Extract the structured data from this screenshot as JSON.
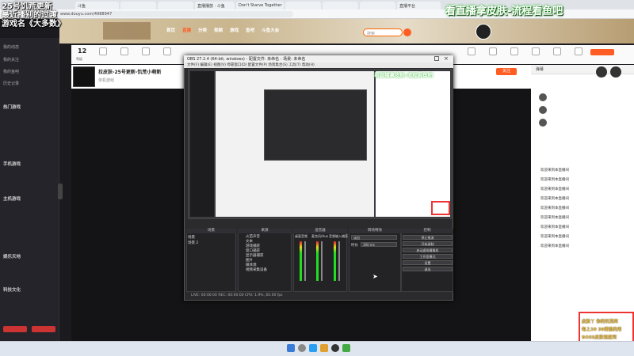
{
  "browser": {
    "tabs": [
      "斗鱼",
      "",
      "",
      "直播播放 · 斗鱼",
      "Don't Starve Together",
      "",
      "",
      "",
      "直播平台"
    ],
    "address": "www.douyu.com/4988947"
  },
  "overlay": {
    "left_caption_line1": "25号饥荒更新",
    "left_caption_line2": "最近播别的过渡",
    "left_caption_line3": "游戏名《大多数》",
    "right_caption": "看直播拿皮肤-流程看鱼吧"
  },
  "banner": {
    "nav": [
      "首页",
      "直播",
      "分类",
      "视频",
      "游戏",
      "鱼吧",
      "斗鱼大会"
    ],
    "search_placeholder": "搜索"
  },
  "sidebar": {
    "top_items": [
      "我的动态",
      "我的关注",
      "我的鱼吧",
      "历史记录"
    ],
    "sections": [
      "热门游戏",
      "手机游戏",
      "主机游戏",
      "娱乐天地",
      "科技文化"
    ]
  },
  "iconrow": {
    "level": "12",
    "labels": [
      "等级",
      "",
      "",
      "",
      "",
      "",
      "",
      "",
      "",
      "",
      "",
      "",
      "",
      "",
      "",
      "",
      "",
      "",
      "",
      "",
      "",
      "",
      "",
      ""
    ]
  },
  "room": {
    "title": "拉皮肤-25号更新-饥荒小萌新",
    "subtitle": "单机游戏",
    "follow_label": "关注"
  },
  "obs": {
    "title": "OBS 27.2.4 (64-bit, windows) - 配置文件: 未命名 - 场景: 未命名",
    "menu": "文件(F)  编辑(E)  视图(V)  停靠窗口(D)  配置文件(P)  场景集合(S)  工具(T)  帮助(H)",
    "preview_caption": "看直播拿皮肤-流程看鱼吧",
    "panels": {
      "scenes": "场景",
      "sources": "来源",
      "mixer": "混音器",
      "transitions": "转场特效",
      "controls": "控制"
    },
    "scene_items": [
      "场景",
      "场景 2"
    ],
    "source_items": [
      "火苗声音",
      "文本",
      "游戏捕获",
      "窗口捕获",
      "显示器捕获",
      "图片",
      "媒体源",
      "视频采集设备"
    ],
    "mixer_channels": [
      "桌面音频",
      "麦克风/Aux",
      "音频输入捕获"
    ],
    "transition_value": "淡出",
    "duration_label": "时长",
    "duration_value": "300 ms",
    "control_buttons": [
      "停止推流",
      "开始录制",
      "启动虚拟摄像机",
      "工作室模式",
      "设置",
      "退出"
    ],
    "status": "LIVE: 00:00:00   REC: 00:00:00   CPU: 1.9%, 60.00 fps"
  },
  "chat": {
    "tab_label": "弹幕",
    "rank": [
      "",
      "",
      ""
    ],
    "messages": [
      {
        "badge": "",
        "text": "欢迎来到本直播间"
      },
      {
        "badge": "",
        "text": "欢迎来到本直播间"
      },
      {
        "badge": "",
        "text": "欢迎来到本直播间"
      },
      {
        "badge": "",
        "text": "欢迎来到本直播间"
      },
      {
        "badge": "",
        "text": "欢迎来到本直播间"
      },
      {
        "badge": "",
        "text": "欢迎来到本直播间"
      },
      {
        "badge": "",
        "text": "欢迎来到本直播间"
      },
      {
        "badge": "",
        "text": "欢迎来到本直播间"
      },
      {
        "badge": "",
        "text": "欢迎来到本直播间"
      }
    ],
    "ad_line1": "皮肤丫 你的饥荒库",
    "ad_line2": "每上20 30储值的用",
    "ad_line3": "BOSS皮肤速度到"
  },
  "colors": {
    "accent": "#ff5d23",
    "caption_green": "#2bd62b",
    "chat_frame": "#e33333"
  }
}
